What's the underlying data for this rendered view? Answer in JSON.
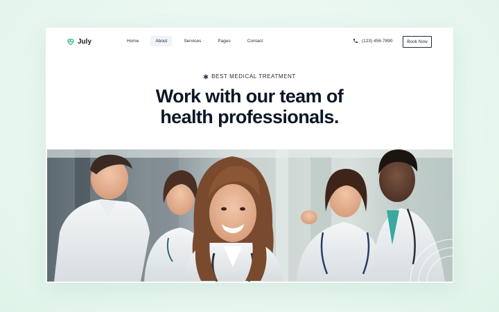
{
  "brand": {
    "name": "July",
    "logo_icon": "heart-pulse-icon",
    "accent": "#2bb58a"
  },
  "nav": {
    "items": [
      {
        "label": "Home",
        "active": false
      },
      {
        "label": "About",
        "active": true
      },
      {
        "label": "Services",
        "active": false
      },
      {
        "label": "Pages",
        "active": false
      },
      {
        "label": "Contact",
        "active": false
      }
    ],
    "phone": "(123) 456-7890",
    "phone_icon": "phone-icon",
    "cta_label": "Book Now"
  },
  "hero": {
    "eyebrow": "BEST MEDICAL TREATMENT",
    "eyebrow_icon": "asterisk-icon",
    "headline_line1": "Work with our team of",
    "headline_line2": "health professionals.",
    "image": "team of medical professionals photo"
  },
  "colors": {
    "page_bg": "#e9f7f0",
    "text_dark": "#0c1726"
  }
}
